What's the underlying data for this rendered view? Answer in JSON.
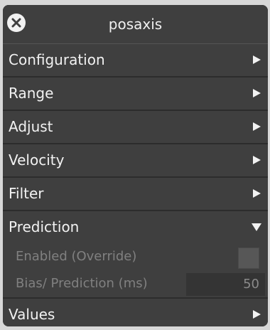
{
  "window": {
    "title": "posaxis"
  },
  "sections": [
    {
      "label": "Configuration",
      "expanded": false
    },
    {
      "label": "Range",
      "expanded": false
    },
    {
      "label": "Adjust",
      "expanded": false
    },
    {
      "label": "Velocity",
      "expanded": false
    },
    {
      "label": "Filter",
      "expanded": false
    },
    {
      "label": "Prediction",
      "expanded": true
    },
    {
      "label": "Values",
      "expanded": false
    }
  ],
  "prediction": {
    "enabled_label": "Enabled  (Override)",
    "enabled_checked": false,
    "bias_label": "Bias/ Prediction (ms)",
    "bias_value": "50"
  },
  "colors": {
    "panel_bg": "#3f3f3f",
    "outer_bg": "#d8d8d8",
    "text": "#f2f2f2",
    "disabled_text": "#808080"
  },
  "icons": {
    "close": "close-icon",
    "collapsed": "triangle-right-icon",
    "expanded": "triangle-down-icon"
  }
}
